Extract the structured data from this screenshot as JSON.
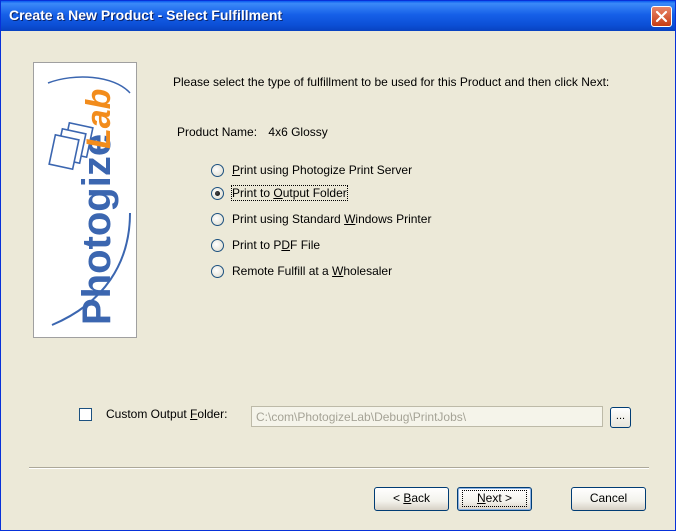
{
  "window": {
    "title": "Create a New Product - Select Fulfillment"
  },
  "logo": {
    "text_part1": "Photogize",
    "text_part2": "Lab",
    "color_blue": "#3b66b0",
    "color_orange": "#f28c1c"
  },
  "instruction": "Please select the type of fulfillment to be used for this Product and then click Next:",
  "product": {
    "label": "Product Name:",
    "value": "4x6 Glossy"
  },
  "fulfillment_options": [
    {
      "pre": "",
      "mnemonic": "P",
      "post": "rint using Photogize Print Server",
      "checked": false
    },
    {
      "pre": "Print to ",
      "mnemonic": "O",
      "post": "utput Folder",
      "checked": true
    },
    {
      "pre": "Print using Standard ",
      "mnemonic": "W",
      "post": "indows Printer",
      "checked": false
    },
    {
      "pre": "Print to P",
      "mnemonic": "D",
      "post": "F File",
      "checked": false
    },
    {
      "pre": "Remote Fulfill at a ",
      "mnemonic": "W",
      "post": "holesaler",
      "checked": false
    }
  ],
  "custom_output": {
    "label_pre": "Custom Output ",
    "label_mnemonic": "F",
    "label_post": "older:",
    "checked": false,
    "path_value": "C:\\com\\PhotogizeLab\\Debug\\PrintJobs\\",
    "browse_label": "..."
  },
  "buttons": {
    "back_pre": "< ",
    "back_mnemonic": "B",
    "back_post": "ack",
    "next_mnemonic": "N",
    "next_post": "ext >",
    "cancel": "Cancel"
  }
}
